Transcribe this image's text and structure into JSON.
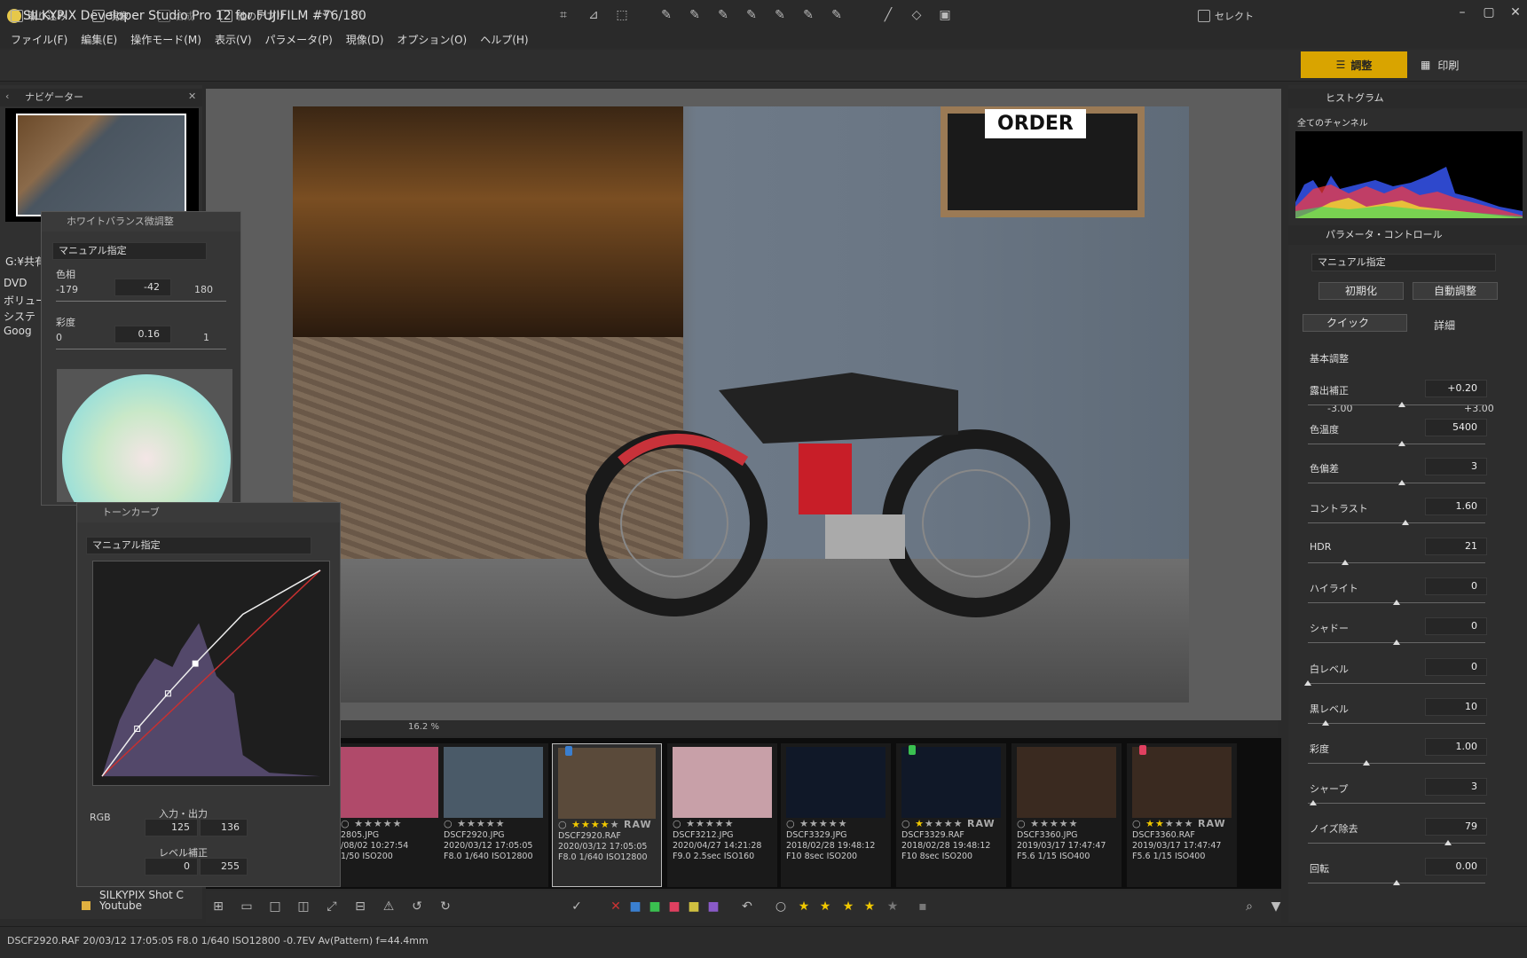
{
  "window": {
    "title": "SILKYPIX Developer Studio Pro 12 for FUJIFILM   #76/180"
  },
  "menu": [
    "ファイル(F)",
    "編集(E)",
    "操作モード(M)",
    "表示(V)",
    "パラメータ(P)",
    "現像(D)",
    "オプション(O)",
    "ヘルプ(H)"
  ],
  "toolbar": {
    "import": "取り込み",
    "develop": "現像",
    "composite": "合成",
    "other_app": "他のアプリ",
    "select": "セレクト",
    "adjust": "調整",
    "print": "印刷"
  },
  "navigator": {
    "title": "ナビゲーター"
  },
  "folder_tree": {
    "path": "G:¥共有",
    "items": [
      "DVD",
      "ボリュー",
      "システ",
      "Goog"
    ],
    "bottom_items": [
      "SILKYPIX Shot C",
      "Youtube"
    ]
  },
  "white_balance": {
    "title": "ホワイトバランス微調整",
    "preset": "マニュアル指定",
    "hue_label": "色相",
    "hue_min": "-179",
    "hue_value": "-42",
    "hue_max": "180",
    "sat_label": "彩度",
    "sat_min": "0",
    "sat_value": "0.16",
    "sat_max": "1"
  },
  "tone_curve": {
    "title": "トーンカーブ",
    "preset": "マニュアル指定",
    "channel": "RGB",
    "io_label": "入力・出力",
    "input": "125",
    "output": "136",
    "level_label": "レベル補正",
    "level_min": "0",
    "level_max": "255"
  },
  "photo": {
    "sign_text": "ORDER"
  },
  "zoom": {
    "value": "16.2",
    "unit": "%"
  },
  "thumbnails": [
    {
      "name": "2805.JPG",
      "date": "/08/02 10:27:54",
      "info": "1/50 ISO200",
      "stars": 0,
      "raw": false,
      "selected": false,
      "tag": ""
    },
    {
      "name": "DSCF2920.JPG",
      "date": "2020/03/12 17:05:05",
      "info": "F8.0 1/640 ISO12800",
      "stars": 0,
      "raw": false,
      "selected": false,
      "tag": ""
    },
    {
      "name": "DSCF2920.RAF",
      "date": "2020/03/12 17:05:05",
      "info": "F8.0 1/640 ISO12800",
      "stars": 4,
      "raw": true,
      "selected": true,
      "tag": "#3a7fd0"
    },
    {
      "name": "DSCF3212.JPG",
      "date": "2020/04/27 14:21:28",
      "info": "F9.0 2.5sec ISO160",
      "stars": 0,
      "raw": false,
      "selected": false,
      "tag": ""
    },
    {
      "name": "DSCF3329.JPG",
      "date": "2018/02/28 19:48:12",
      "info": "F10 8sec ISO200",
      "stars": 0,
      "raw": false,
      "selected": false,
      "tag": ""
    },
    {
      "name": "DSCF3329.RAF",
      "date": "2018/02/28 19:48:12",
      "info": "F10 8sec ISO200",
      "stars": 1,
      "raw": true,
      "selected": false,
      "tag": "#3ac050"
    },
    {
      "name": "DSCF3360.JPG",
      "date": "2019/03/17 17:47:47",
      "info": "F5.6 1/15 ISO400",
      "stars": 0,
      "raw": false,
      "selected": false,
      "tag": ""
    },
    {
      "name": "DSCF3360.RAF",
      "date": "2019/03/17 17:47:47",
      "info": "F5.6 1/15 ISO400",
      "stars": 2,
      "raw": true,
      "selected": false,
      "tag": "#e04060"
    }
  ],
  "histogram": {
    "title": "ヒストグラム",
    "channel": "全てのチャンネル"
  },
  "param_control": {
    "title": "パラメータ・コントロール",
    "preset": "マニュアル指定",
    "reset_btn": "初期化",
    "auto_btn": "自動調整",
    "quick_tab": "クイック",
    "detail_tab": "詳細",
    "section": "基本調整",
    "exposure_min": "-3.00",
    "exposure_max": "+3.00",
    "params": [
      {
        "label": "露出補正",
        "value": "+0.20",
        "level": 0.53
      },
      {
        "label": "色温度",
        "value": "5400",
        "level": 0.53
      },
      {
        "label": "色偏差",
        "value": "3",
        "level": 0.53
      },
      {
        "label": "コントラスト",
        "value": "1.60",
        "level": 0.55
      },
      {
        "label": "HDR",
        "value": "21",
        "level": 0.21
      },
      {
        "label": "ハイライト",
        "value": "0",
        "level": 0.5
      },
      {
        "label": "シャドー",
        "value": "0",
        "level": 0.5
      },
      {
        "label": "白レベル",
        "value": "0",
        "level": 0.0
      },
      {
        "label": "黒レベル",
        "value": "10",
        "level": 0.1
      },
      {
        "label": "彩度",
        "value": "1.00",
        "level": 0.33
      },
      {
        "label": "シャープ",
        "value": "3",
        "level": 0.03
      },
      {
        "label": "ノイズ除去",
        "value": "79",
        "level": 0.79
      },
      {
        "label": "回転",
        "value": "0.00",
        "level": 0.5
      }
    ]
  },
  "status": {
    "text": "DSCF2920.RAF 20/03/12 17:05:05 F8.0 1/640 ISO12800 -0.7EV Av(Pattern) f=44.4mm"
  }
}
